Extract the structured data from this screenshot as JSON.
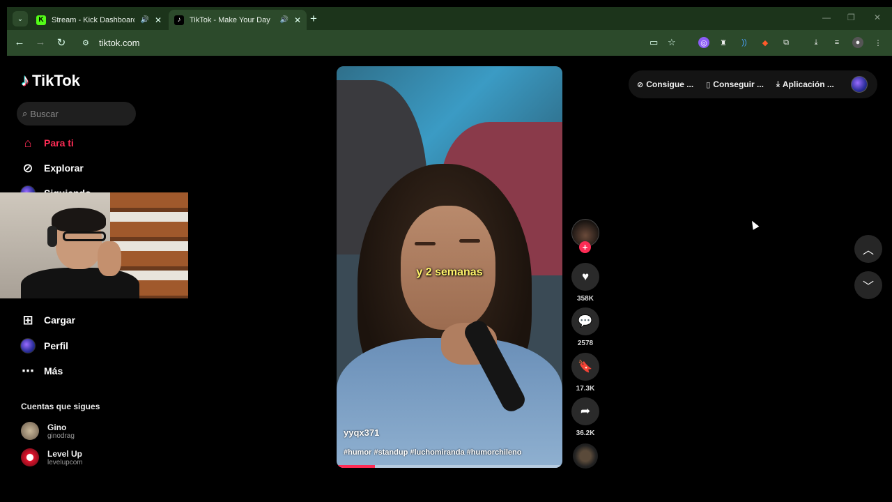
{
  "browser": {
    "tabs": [
      {
        "title": "Stream - Kick Dashboard",
        "favicon": "K"
      },
      {
        "title": "TikTok - Make Your Day",
        "favicon": "♪"
      }
    ],
    "new_tab": "+",
    "url": "tiktok.com"
  },
  "sidebar": {
    "logo": "TikTok",
    "search_placeholder": "Buscar",
    "nav": [
      {
        "label": "Para ti",
        "icon": "home-icon"
      },
      {
        "label": "Explorar",
        "icon": "compass-icon"
      },
      {
        "label": "Siguiendo",
        "icon": "following-avatar"
      },
      {
        "label": "Cargar",
        "icon": "upload-icon"
      },
      {
        "label": "Perfil",
        "icon": "profile-avatar"
      },
      {
        "label": "Más",
        "icon": "more-icon"
      }
    ],
    "following_title": "Cuentas que sigues",
    "following": [
      {
        "name": "Gino",
        "user": "ginodrag"
      },
      {
        "name": "Level Up",
        "user": "levelupcom"
      }
    ]
  },
  "video": {
    "caption": "y 2 semanas",
    "username": "yyqx371",
    "hashtags": "#humor #standup #luchomiranda #humorchileno",
    "progress": 0.17
  },
  "actions": {
    "likes": "358K",
    "comments": "2578",
    "saves": "17.3K",
    "shares": "36.2K"
  },
  "topbar": {
    "coins": "Consigue ...",
    "get_app": "Conseguir ...",
    "download": "Aplicación ..."
  },
  "colors": {
    "accent": "#fe2c55",
    "caption": "#fff36a",
    "browser_frame": "#1f3a1f"
  }
}
